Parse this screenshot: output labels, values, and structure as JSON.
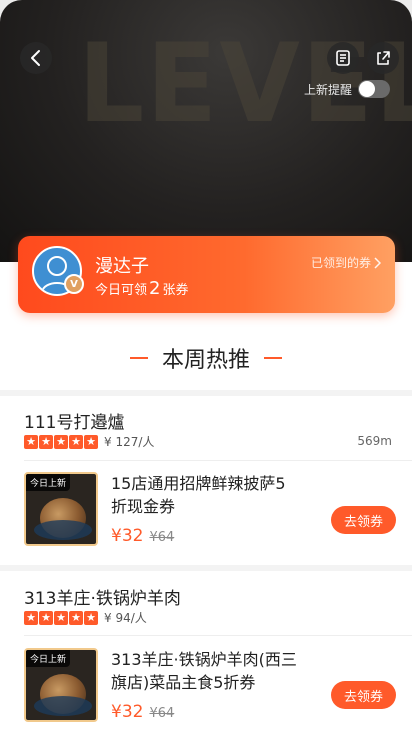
{
  "hero": {
    "watermark": "LEVEL"
  },
  "header": {
    "notify_label": "上新提醒",
    "notify_enabled": false
  },
  "member": {
    "name": "漫达子",
    "coupon_prefix": "今日可领",
    "coupon_count": "2",
    "coupon_suffix": "张券",
    "claimed_link": "已领到的券",
    "badge": "V"
  },
  "section": {
    "title": "本周热推"
  },
  "stores": [
    {
      "name": "111号打邉爐",
      "price_per_person": "¥ 127/人",
      "distance": "569m",
      "deal": {
        "tag": "今日上新",
        "title": "15店通用招牌鲜辣披萨5折现金券",
        "price": "¥32",
        "old_price": "¥64",
        "button": "去领券"
      }
    },
    {
      "name": "313羊庄·铁锅炉羊肉",
      "price_per_person": "¥ 94/人",
      "distance": "",
      "deal": {
        "tag": "今日上新",
        "title": "313羊庄·铁锅炉羊肉(西三旗店)菜品主食5折券",
        "price": "¥32",
        "old_price": "¥64",
        "button": "去领券"
      }
    }
  ],
  "colors": {
    "accent": "#ff5a2a"
  }
}
